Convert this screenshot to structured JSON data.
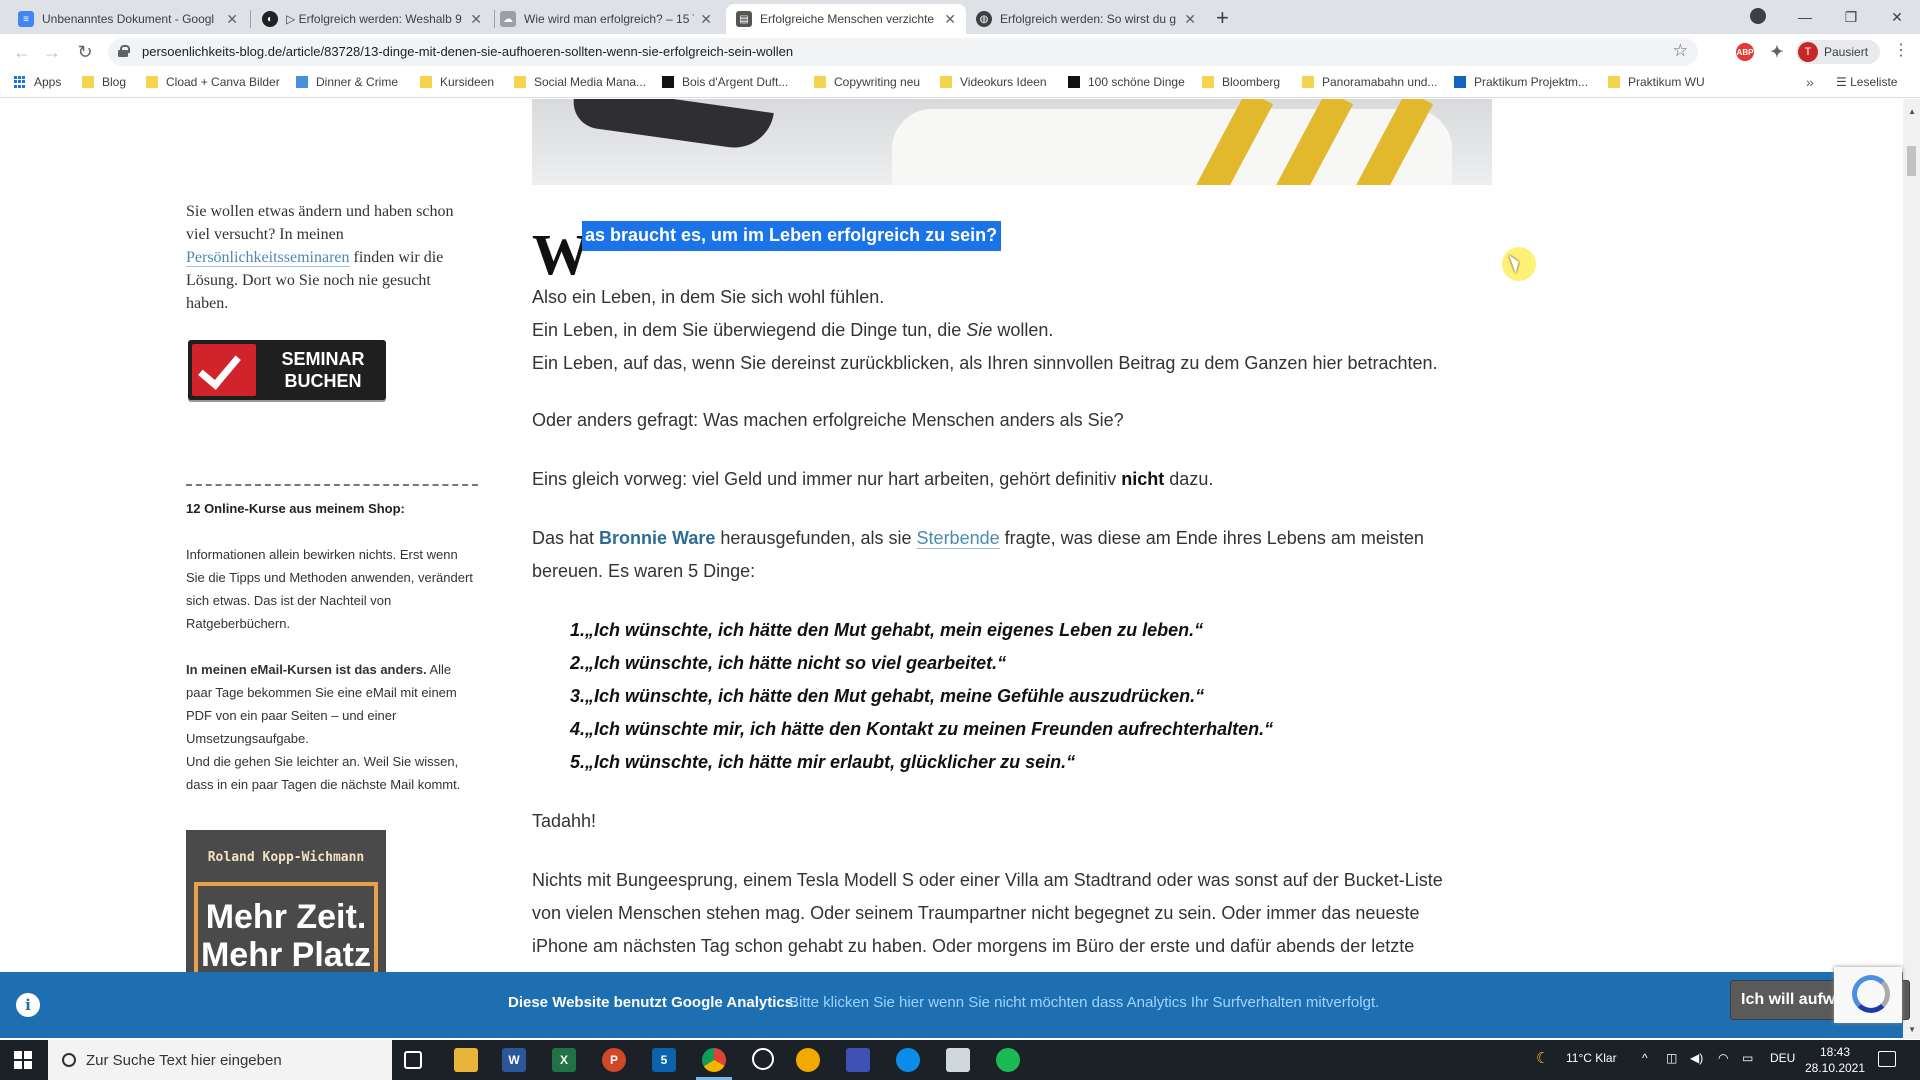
{
  "browser": {
    "tabs": [
      {
        "title": "Unbenanntes Dokument - Googl",
        "favicon_color": "#4285f4",
        "active": false
      },
      {
        "title": "▷ Erfolgreich werden: Weshalb 9",
        "favicon_color": "#202124",
        "active": false
      },
      {
        "title": "Wie wird man erfolgreich? – 15 T",
        "favicon_color": "#9aa0a6",
        "active": false
      },
      {
        "title": "Erfolgreiche Menschen verzichte",
        "favicon_color": "#555555",
        "active": true
      },
      {
        "title": "Erfolgreich werden: So wirst du g",
        "favicon_color": "#3c4043",
        "active": false
      }
    ],
    "url": "persoenlichkeits-blog.de/article/83728/13-dinge-mit-denen-sie-aufhoeren-sollten-wenn-sie-erfolgreich-sein-wollen",
    "profile_initial": "T",
    "profile_label": "Pausiert",
    "abp_label": "ABP",
    "bookmarks": [
      {
        "label": "Apps",
        "icon": "apps-grid-icon"
      },
      {
        "label": "Blog",
        "icon": "folder-icon"
      },
      {
        "label": "Cload + Canva Bilder",
        "icon": "folder-icon"
      },
      {
        "label": "Dinner & Crime",
        "icon": "site-icon"
      },
      {
        "label": "Kursideen",
        "icon": "folder-icon"
      },
      {
        "label": "Social Media Mana...",
        "icon": "folder-icon"
      },
      {
        "label": "Bois d'Argent Duft...",
        "icon": "site-icon"
      },
      {
        "label": "Copywriting neu",
        "icon": "folder-icon"
      },
      {
        "label": "Videokurs Ideen",
        "icon": "folder-icon"
      },
      {
        "label": "100 schöne Dinge",
        "icon": "site-icon"
      },
      {
        "label": "Bloomberg",
        "icon": "folder-icon"
      },
      {
        "label": "Panoramabahn und...",
        "icon": "folder-icon"
      },
      {
        "label": "Praktikum Projektm...",
        "icon": "site-icon"
      },
      {
        "label": "Praktikum WU",
        "icon": "folder-icon"
      }
    ],
    "reading_list": "Leseliste"
  },
  "sidebar": {
    "promo_before": "Sie wollen etwas ändern und haben schon viel versucht? In meinen ",
    "promo_link": "Persönlichkeitsseminaren",
    "promo_after": " finden wir die Lösung. Dort wo Sie noch nie gesucht haben.",
    "seminar_button": "SEMINAR BUCHEN",
    "shop_heading": "12 Online-Kurse aus meinem Shop:",
    "shop_text": "Informationen allein bewirken nichts. Erst wenn Sie die Tipps und Methoden anwenden, verändert sich etwas. Das ist der Nachteil von Ratgeberbüchern.",
    "email_bold": "In meinen eMail-Kursen ist das anders.",
    "email_text": " Alle paar Tage bekommen Sie eine eMail mit einem PDF von ein paar Seiten – und einer Umsetzungsaufgabe.",
    "email_text2": "Und die gehen Sie leichter an. Weil Sie wissen, dass in ein paar Tagen die nächste Mail kommt.",
    "book_author": "Roland Kopp-Wichmann",
    "book_title": "Mehr Zeit. Mehr Platz"
  },
  "article": {
    "heading_dropcap": "W",
    "heading_rest": "as braucht es, um im Leben erfolgreich zu sein?",
    "p1_line1": "Also ein Leben, in dem Sie sich wohl fühlen.",
    "p1_line2_before": "Ein Leben, in dem Sie überwiegend die Dinge tun, die ",
    "p1_line2_em": "Sie",
    "p1_line2_after": " wollen.",
    "p1_line3": "Ein Leben, auf das, wenn Sie dereinst zurückblicken, als Ihren sinnvollen Beitrag zu dem Ganzen hier betrachten.",
    "p2": "Oder anders gefragt: Was machen erfolgreiche Menschen anders als Sie?",
    "p3_before": "Eins gleich vorweg: viel Geld und immer nur hart arbeiten, gehört definitiv ",
    "p3_bold": "nicht",
    "p3_after": " dazu.",
    "p4_a": "Das hat ",
    "p4_link1": "Bronnie Ware",
    "p4_b": " herausgefunden, als sie ",
    "p4_link2": "Sterbende",
    "p4_c": " fragte, was diese am Ende ihres Lebens am meisten",
    "p4_d": "bereuen. Es waren 5 Dinge:",
    "regrets": [
      "1.„Ich wünschte, ich hätte den Mut gehabt, mein eigenes Leben zu leben.“",
      "2.„Ich wünschte, ich hätte nicht so viel gearbeitet.“",
      "3.„Ich wünschte, ich hätte den Mut gehabt, meine Gefühle auszudrücken.“",
      "4.„Ich wünschte mir, ich hätte den Kontakt zu meinen Freunden aufrechterhalten.“",
      "5.„Ich wünschte, ich hätte mir erlaubt, glücklicher zu sein.“"
    ],
    "tadah": "Tadahh!",
    "p6_line1": "Nichts mit Bungeesprung, einem Tesla Modell S oder einer Villa am Stadtrand oder was sonst auf der Bucket-Liste",
    "p6_line2": "von vielen Menschen stehen mag.  Oder seinem Traumpartner nicht begegnet zu sein. Oder immer das neueste",
    "p6_line3": "iPhone am nächsten Tag schon gehabt zu haben. Oder morgens im Büro der erste und dafür abends der letzte"
  },
  "cookie_bar": {
    "message": "Diese Website benutzt Google Analytics.",
    "link": "Bitte klicken Sie hier wenn Sie nicht möchten dass Analytics Ihr Surfverhalten mitverfolgt.",
    "accept": "Ich will aufw"
  },
  "taskbar": {
    "search_placeholder": "Zur Suche Text hier eingeben",
    "mail_badge": "5",
    "weather": "11°C  Klar",
    "language": "DEU",
    "time": "18:43",
    "date": "28.10.2021"
  },
  "colors": {
    "highlight": "#1a73e8",
    "link": "#4a8bb2",
    "cookie_bar": "#1e6fb2",
    "seminar_red": "#d1232a"
  }
}
